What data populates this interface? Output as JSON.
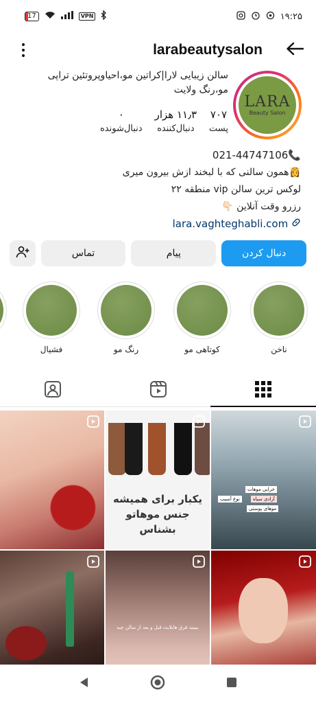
{
  "status_bar": {
    "battery": "17",
    "vpn": "VPN",
    "time": "۱۹:۲۵"
  },
  "header": {
    "username": "larabeautysalon"
  },
  "profile": {
    "avatar_text": "LARA",
    "avatar_subtext": "Beauty Salon",
    "bio_name": "سالن زیبایی لارا|کراتین مو،احیاوپروتئین تراپی مو،رنگ ولایت",
    "stats": [
      {
        "value": "۷۰۷",
        "label": "پست"
      },
      {
        "value": "۱۱٫۳ هزار",
        "label": "دنبال‌کننده"
      },
      {
        "value": "۰",
        "label": "دنبال‌شونده"
      }
    ],
    "phone": "021-44747106📞",
    "bio_lines": [
      "👸همون سالنی که با لبخند ازش بیرون میری",
      "لوکس ترین سالن vip منطقه ۲۲",
      "رزرو وقت آنلاین 👇🏻"
    ],
    "link": "lara.vaghteghabli.com"
  },
  "actions": {
    "follow": "دنبال کردن",
    "message": "پیام",
    "contact": "تماس"
  },
  "highlights": [
    {
      "label": "ناخن"
    },
    {
      "label": "کوتاهی مو"
    },
    {
      "label": "رنگ مو"
    },
    {
      "label": "فشیال"
    },
    {
      "label": ""
    }
  ],
  "posts": {
    "post2_caption": "یکبار برای همیشه جنس موهاتو بشناس",
    "post3_tags": [
      "خرابی موهات",
      "آزادی سیاه",
      "نوع آسیب",
      "موهای پوستی"
    ],
    "post5_caption": "ببینید فرق هایلایت قبل و بعد از سالن چیه"
  },
  "colors": {
    "follow_button": "#1d9bf0",
    "secondary_button": "#efefef",
    "link": "#00376b",
    "highlight_cover": "#6b8b45"
  }
}
